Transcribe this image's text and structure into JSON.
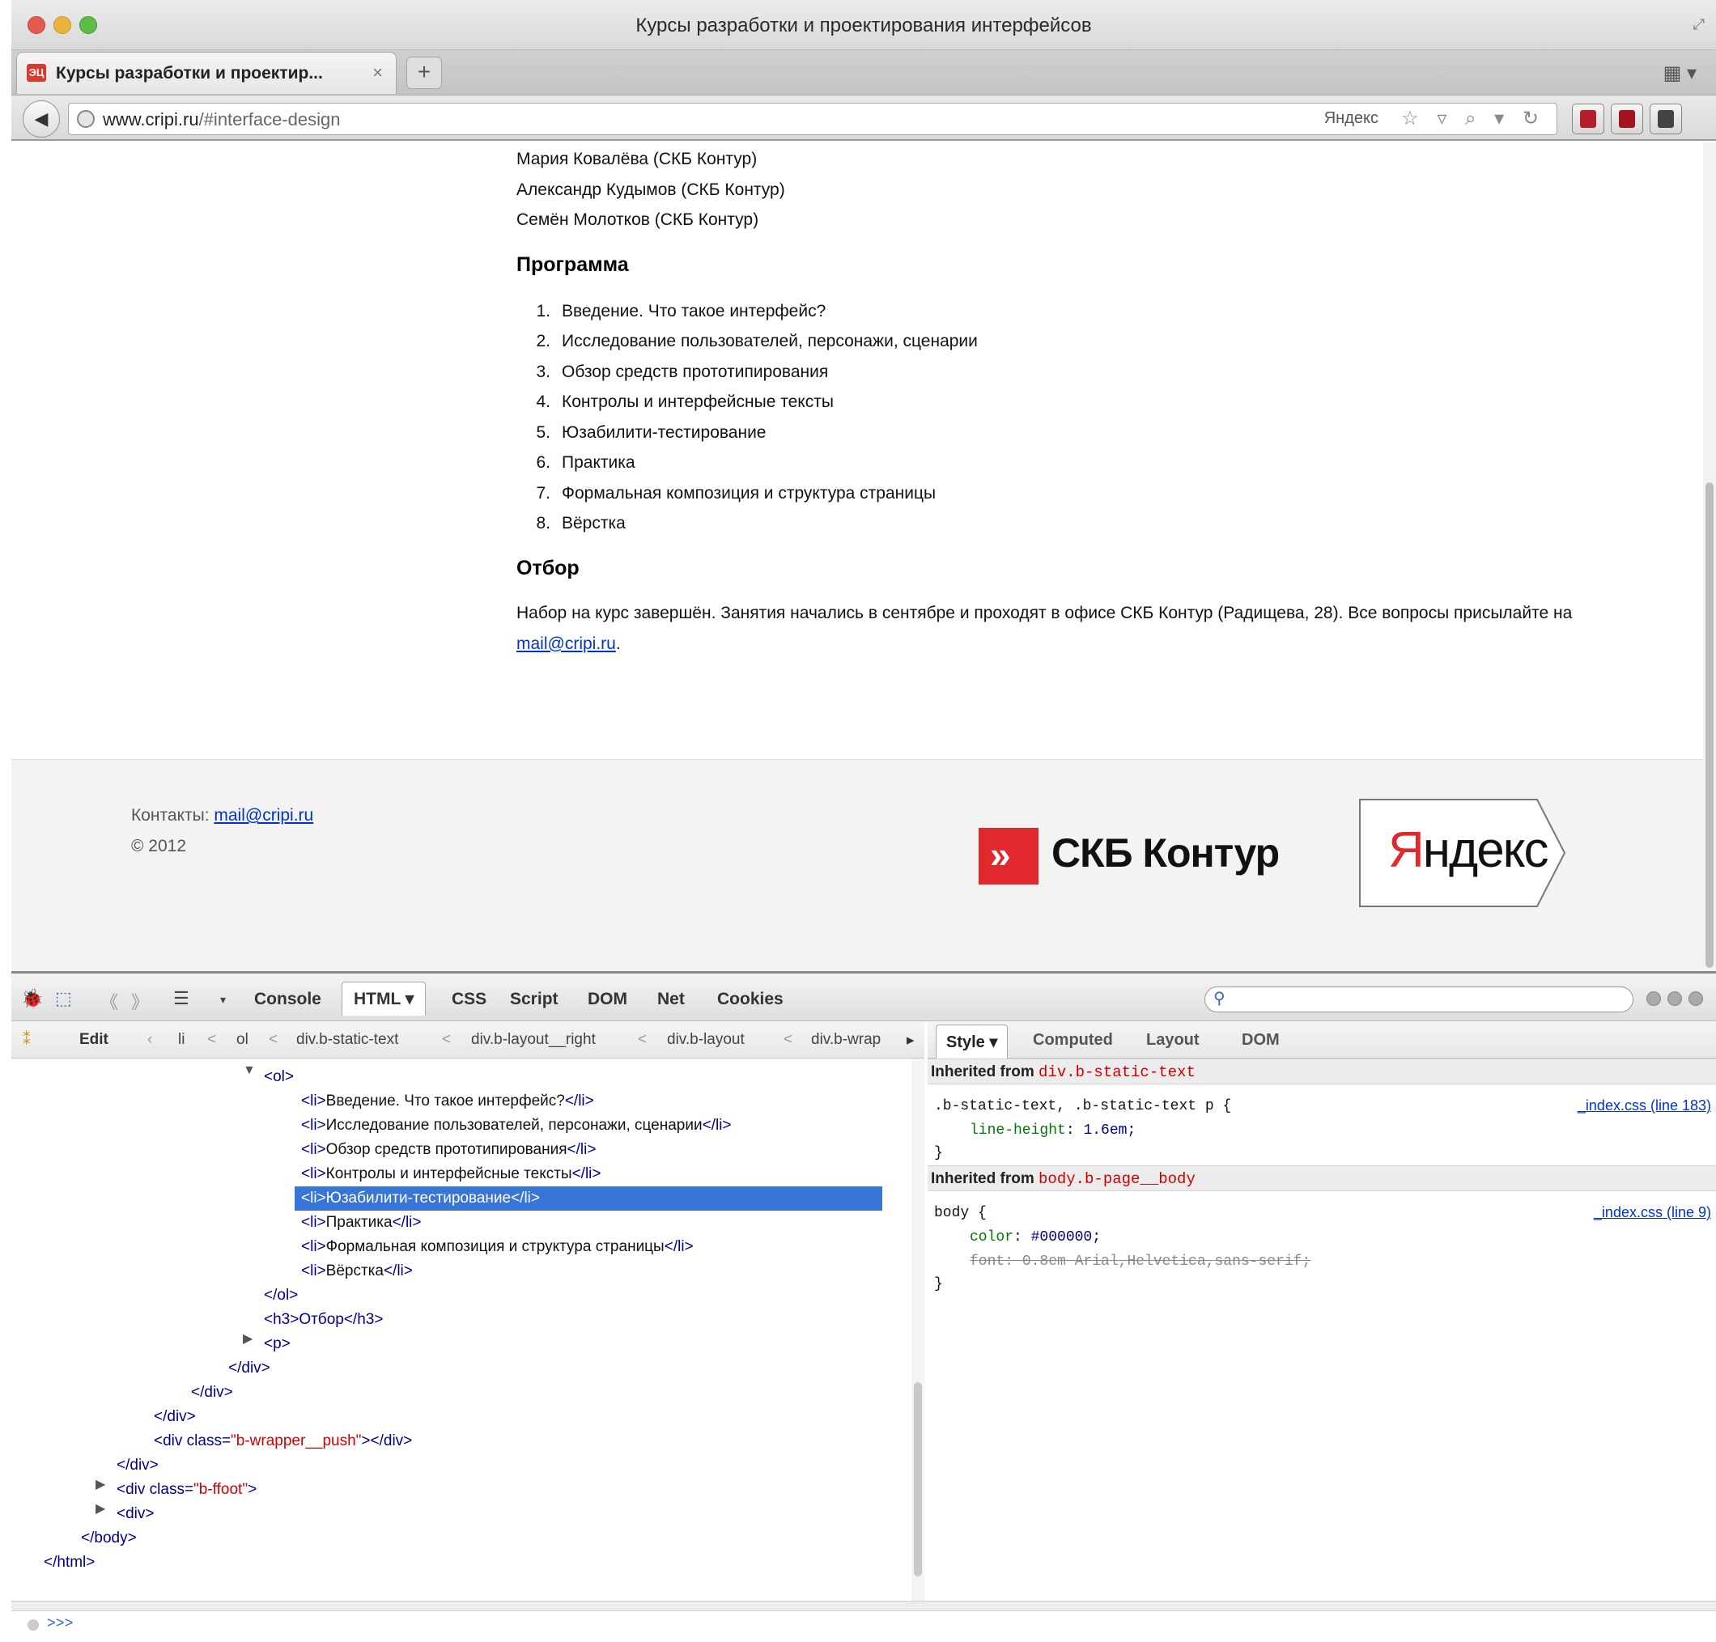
{
  "window": {
    "title": "Курсы разработки и проектирования интерфейсов"
  },
  "tab": {
    "label": "Курсы разработки и проектир...",
    "favicon_text": "ЭЦ"
  },
  "navbar": {
    "url_domain": "www.cripi.ru",
    "url_path": "/#interface-design",
    "search_engine": "Яндекс"
  },
  "page": {
    "authors": [
      "Мария Ковалёва (СКБ Контур)",
      "Александр Кудымов (СКБ Контур)",
      "Семён Молотков (СКБ Контур)"
    ],
    "program_heading": "Программа",
    "program_items": [
      {
        "num": "1.",
        "text": "Введение. Что такое интерфейс?"
      },
      {
        "num": "2.",
        "text": "Исследование пользователей, персонажи, сценарии"
      },
      {
        "num": "3.",
        "text": "Обзор средств прототипирования"
      },
      {
        "num": "4.",
        "text": "Контролы и интерфейсные тексты"
      },
      {
        "num": "5.",
        "text": "Юзабилити-тестирование"
      },
      {
        "num": "6.",
        "text": "Практика"
      },
      {
        "num": "7.",
        "text": "Формальная композиция и структура страницы"
      },
      {
        "num": "8.",
        "text": "Вёрстка"
      }
    ],
    "selection_heading": "Отбор",
    "selection_text_before": "Набор на курс завершён. Занятия начались в сентябре и проходят в офисе СКБ Контур (Радищева, 28). Все вопросы присылайте на ",
    "selection_link": "mail@cripi.ru",
    "selection_text_after": "."
  },
  "footer": {
    "contacts_label": "Контакты: ",
    "contacts_link": "mail@cripi.ru",
    "copyright": "© 2012",
    "kontur_logo": "СКБ Контур",
    "yandex_logo_first": "Я",
    "yandex_logo_rest": "ндекс"
  },
  "firebug": {
    "tabs": [
      "Console",
      "HTML ▾",
      "CSS",
      "Script",
      "DOM",
      "Net",
      "Cookies"
    ],
    "breadcrumbs": {
      "edit": "Edit",
      "items": [
        "li",
        "ol",
        "div.b-static-text",
        "div.b-layout__right",
        "div.b-layout",
        "div.b-wrap"
      ]
    },
    "tree": {
      "ol_open": "<ol>",
      "li_items": [
        "Введение. Что такое интерфейс?",
        "Исследование пользователей, персонажи, сценарии",
        "Обзор средств прототипирования",
        "Контролы и интерфейсные тексты",
        "Юзабилити-тестирование",
        "Практика",
        "Формальная композиция и структура страницы",
        "Вёрстка"
      ],
      "selected_index": 4,
      "ol_close": "</ol>",
      "h3_line": "<h3>Отбор</h3>",
      "p_line": "<p>",
      "div_close_1": "</div>",
      "div_close_2": "</div>",
      "div_close_3": "</div>",
      "push_div_open": "<div class=",
      "push_div_class": "\"b-wrapper__push\"",
      "push_div_close": "></div>",
      "div_close_4": "</div>",
      "ffoot_div_open": "<div class=",
      "ffoot_div_class": "\"b-ffoot\"",
      "ffoot_div_close": ">",
      "div_line": "<div>",
      "body_close": "</body>",
      "html_close": "</html>"
    },
    "side_tabs": [
      "Style ▾",
      "Computed",
      "Layout",
      "DOM"
    ],
    "styles": [
      {
        "inherited_label": "Inherited from ",
        "inherited_selector": "div.b-static-text",
        "selector": ".b-static-text, .b-static-text p {",
        "source": "_index.css (line 183)",
        "props": [
          {
            "name": "line-height",
            "value": "1.6em;",
            "overridden": false
          }
        ]
      },
      {
        "inherited_label": "Inherited from ",
        "inherited_selector": "body.b-page__body",
        "selector": "body {",
        "source": "_index.css (line 9)",
        "props": [
          {
            "name": "color",
            "value": "#000000;",
            "overridden": false
          },
          {
            "name": "font",
            "value": "0.8em Arial,Helvetica,sans-serif;",
            "overridden": true
          }
        ]
      }
    ],
    "close_brace": "}",
    "cmd_prompt": ">>>"
  }
}
